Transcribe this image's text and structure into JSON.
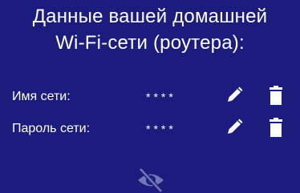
{
  "title": {
    "line1": "Данные вашей домашней",
    "line2": "Wi-Fi-сети (роутера):"
  },
  "fields": [
    {
      "label": "Имя сети:",
      "value": "****"
    },
    {
      "label": "Пароль сети:",
      "value": "****"
    }
  ],
  "icons": {
    "edit": "pencil-icon",
    "delete": "trash-icon",
    "visibility": "eye-slash-icon"
  },
  "colors": {
    "background": "#1c1c7e",
    "text": "#ffffff",
    "eye_icon": "#6f78b4"
  }
}
